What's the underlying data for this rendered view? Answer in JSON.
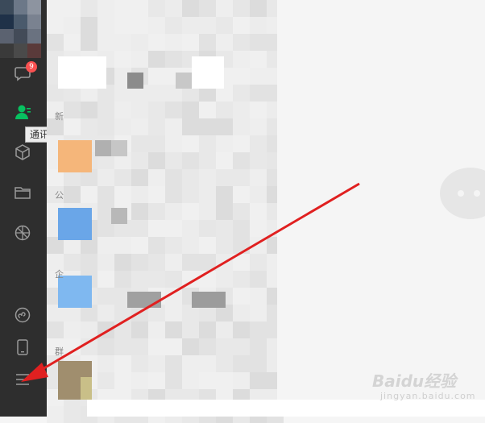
{
  "sidebar": {
    "chat_badge": "9",
    "contacts_tooltip": "通讯录",
    "items": [
      {
        "icon": "chat-bubble-icon"
      },
      {
        "icon": "contacts-icon"
      },
      {
        "icon": "cube-icon"
      },
      {
        "icon": "folder-icon"
      },
      {
        "icon": "moments-icon"
      },
      {
        "icon": "miniprogram-icon"
      },
      {
        "icon": "phone-icon"
      },
      {
        "icon": "menu-icon"
      }
    ],
    "active_color": "#07c160"
  },
  "list": {
    "section_glyphs": [
      "新",
      "公",
      "企",
      "群"
    ]
  },
  "watermark": {
    "main": "Baidu经验",
    "sub": "jingyan.baidu.com"
  },
  "annotation": {
    "arrow_color": "#e02020"
  }
}
